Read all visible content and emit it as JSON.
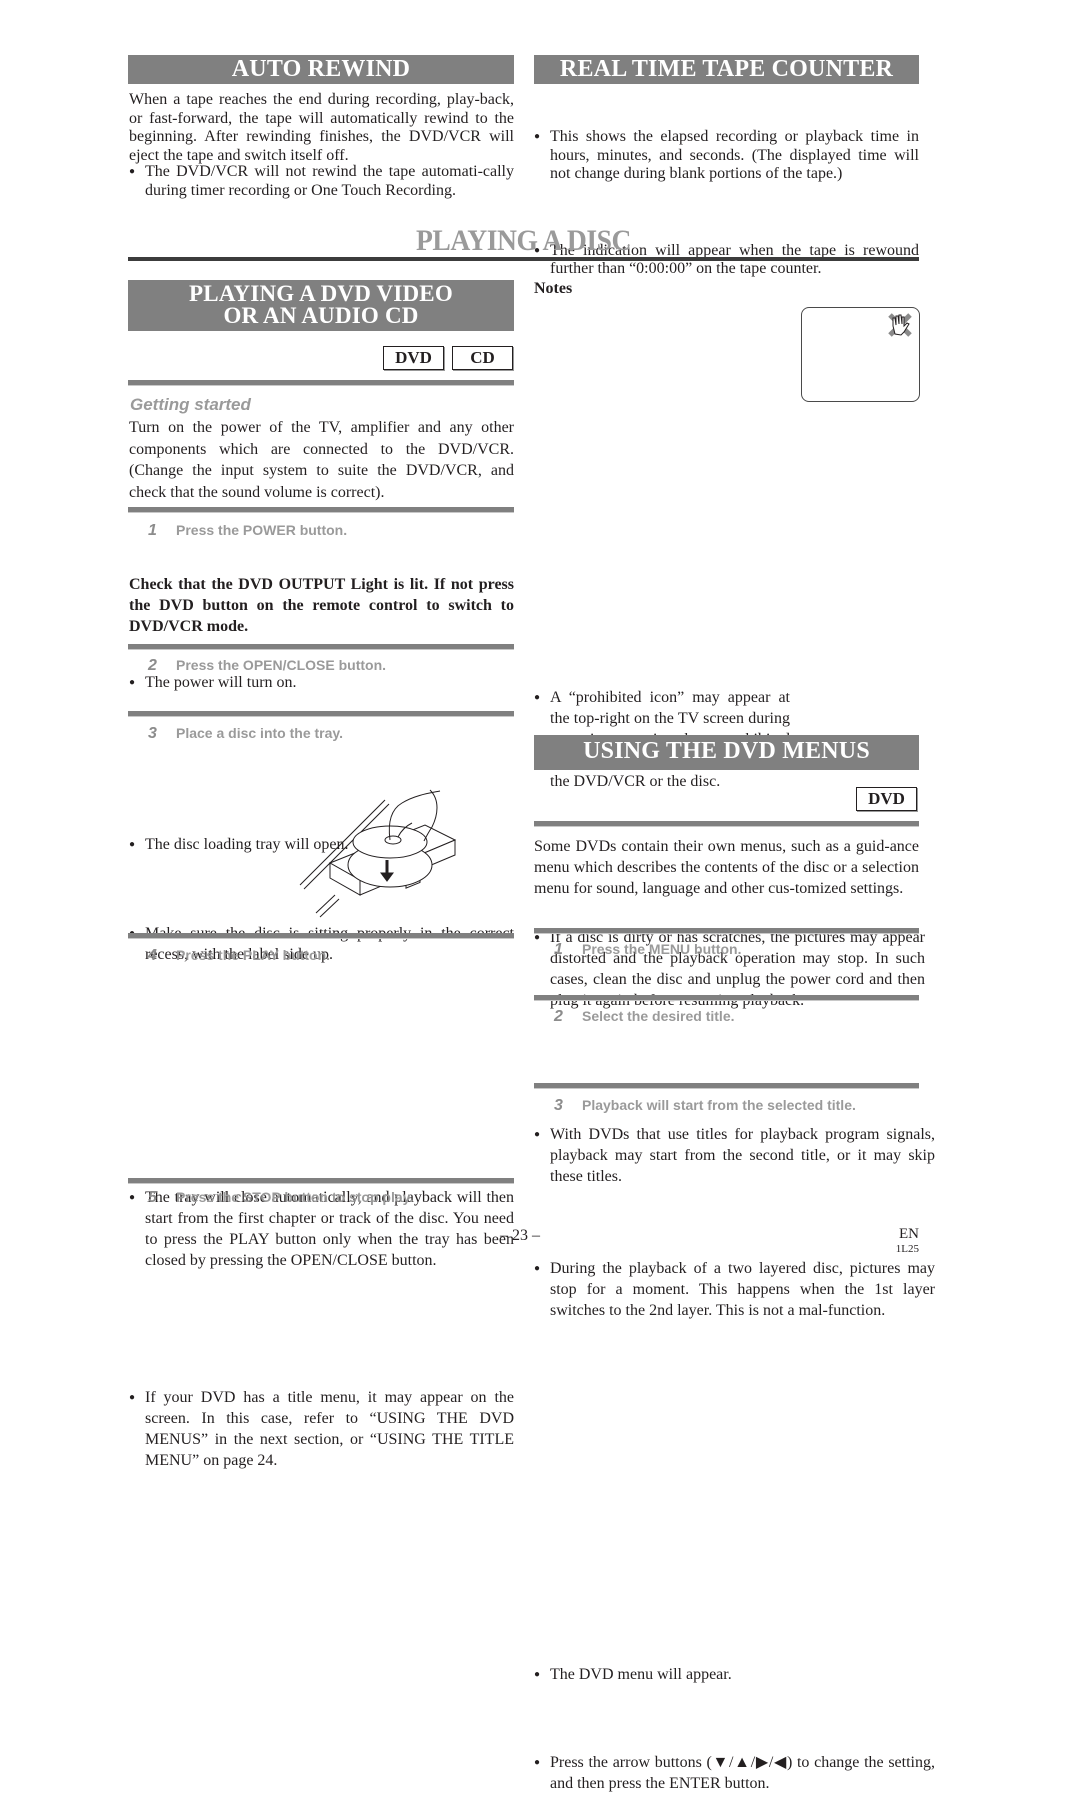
{
  "auto_rewind": {
    "title": "AUTO REWIND",
    "paragraph": "When a tape reaches the end during recording, play-back, or fast-forward, the tape will automatically rewind to the beginning. After rewinding finishes, the DVD/VCR will eject the tape and switch itself off.",
    "bullets": [
      "The DVD/VCR will not rewind the tape automati-cally during timer recording or One Touch Recording."
    ]
  },
  "tape_counter": {
    "title": "REAL TIME TAPE COUNTER",
    "bullets": [
      "This shows the elapsed recording or playback time in hours, minutes, and seconds. (The displayed time will not change during blank portions of the tape.)",
      "The indication will appear when the tape is rewound further than “0:00:00” on the tape counter."
    ]
  },
  "page_title": "PLAYING A DISC",
  "playing_dvd": {
    "title_line1": "PLAYING A DVD VIDEO",
    "title_line2": "OR AN AUDIO CD",
    "tags": [
      "DVD",
      "CD"
    ],
    "getting_started_heading": "Getting started",
    "getting_started_text": "Turn on the power of the TV, amplifier and any other components which are connected to the DVD/VCR. (Change the input system to suite the DVD/VCR, and check that the sound volume is correct).",
    "steps": [
      {
        "num": "1",
        "label": "Press the POWER button.",
        "bullets": [
          "The power will turn on."
        ]
      },
      {
        "num": "2",
        "label": "Press the OPEN/CLOSE button.",
        "bullets": [
          "The disc loading tray will open."
        ]
      },
      {
        "num": "3",
        "label": "Place a disc into the tray.",
        "bullets": [
          "Make sure the disc is sitting properly in the correct recess, with the label side up."
        ]
      },
      {
        "num": "4",
        "label": "Press the PLAY button.",
        "bullets": [
          "The tray will close automatically, and playback will then start from the first chapter or track of the disc. You need to press the PLAY button only when the tray has been closed by pressing the OPEN/CLOSE button.",
          "If your DVD has a title menu, it may appear on the screen. In this case, refer to “USING THE DVD MENUS” in the next section, or “USING THE TITLE MENU” on page 24."
        ]
      },
      {
        "num": "5",
        "label": "Press the STOP button to stop play.",
        "bullets": []
      }
    ],
    "bold_note": "Check that the DVD OUTPUT Light is lit.  If not press the DVD button on the remote control to switch to DVD/VCR mode.",
    "illustration": "disc-tray-illustration"
  },
  "notes": {
    "heading": "Notes",
    "bullets": [
      "A “prohibited icon” may appear at the top-right on the TV screen during operation, warning that a prohibited operation has been encountered by the DVD/VCR or the disc.",
      "If a disc is dirty or has scratches, the pictures may appear distorted and the playback operation may stop. In such cases, clean the disc and unplug the power cord and then plug it again before resuming playback.",
      "With DVDs that use titles for playback program signals, playback may start from the second title, or it may skip these titles.",
      "During the playback of a two layered disc, pictures may stop for a moment. This happens when the 1st layer switches to the 2nd layer. This is not a mal-function."
    ],
    "icon": "prohibited-hand-icon"
  },
  "dvd_menus": {
    "title": "USING THE DVD MENUS",
    "tags": [
      "DVD"
    ],
    "paragraph": "Some DVDs contain their own menus, such as a guid-ance menu which describes the contents of the disc or a selection menu for sound, language and other cus-tomized settings.",
    "steps": [
      {
        "num": "1",
        "label": "Press the MENU button.",
        "bullets": [
          "The DVD menu will appear."
        ]
      },
      {
        "num": "2",
        "label": "Select the desired title.",
        "bullets": [
          "Press the arrow buttons (▼/▲/▶/◀) to change the setting, and then press the ENTER button."
        ]
      },
      {
        "num": "3",
        "label": "Playback will start from the selected title.",
        "bullets": []
      }
    ]
  },
  "footer": {
    "page_number": "– 23 –",
    "language": "EN",
    "code": "1L25"
  },
  "colors": {
    "banner_gray": "#808080",
    "title_gray": "#9a9a9a",
    "text": "#231f20"
  }
}
